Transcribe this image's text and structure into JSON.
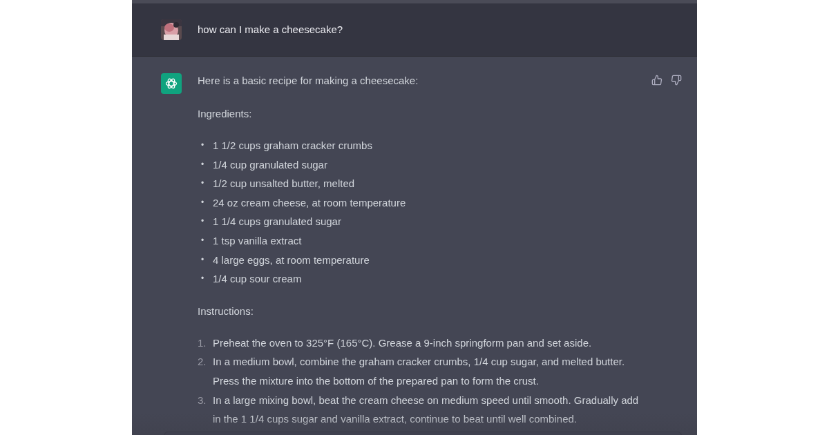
{
  "user_message": {
    "text": "how can I make a cheesecake?"
  },
  "assistant_message": {
    "intro": "Here is a basic recipe for making a cheesecake:",
    "ingredients_heading": "Ingredients:",
    "ingredients": [
      {
        "bullet": "•",
        "text": "1 1/2 cups graham cracker crumbs"
      },
      {
        "bullet": "•",
        "text": "1/4 cup granulated sugar"
      },
      {
        "bullet": "•",
        "text": "1/2 cup unsalted butter, melted"
      },
      {
        "bullet": "•",
        "text": "24 oz cream cheese, at room temperature"
      },
      {
        "bullet": "•",
        "text": "1 1/4 cups granulated sugar"
      },
      {
        "bullet": "•",
        "text": "1 tsp vanilla extract"
      },
      {
        "bullet": "•",
        "text": "4 large eggs, at room temperature"
      },
      {
        "bullet": "•",
        "text": "1/4 cup sour cream"
      }
    ],
    "instructions_heading": "Instructions:",
    "instructions": [
      {
        "number": "1.",
        "text": "Preheat the oven to 325°F (165°C). Grease a 9-inch springform pan and set aside."
      },
      {
        "number": "2.",
        "text": "In a medium bowl, combine the graham cracker crumbs, 1/4 cup sugar, and melted butter. Press the mixture into the bottom of the prepared pan to form the crust."
      },
      {
        "number": "3.",
        "text": "In a large mixing bowl, beat the cream cheese on medium speed until smooth. Gradually add in the 1 1/4 cups sugar and vanilla extract, continue to beat until well combined."
      }
    ]
  }
}
